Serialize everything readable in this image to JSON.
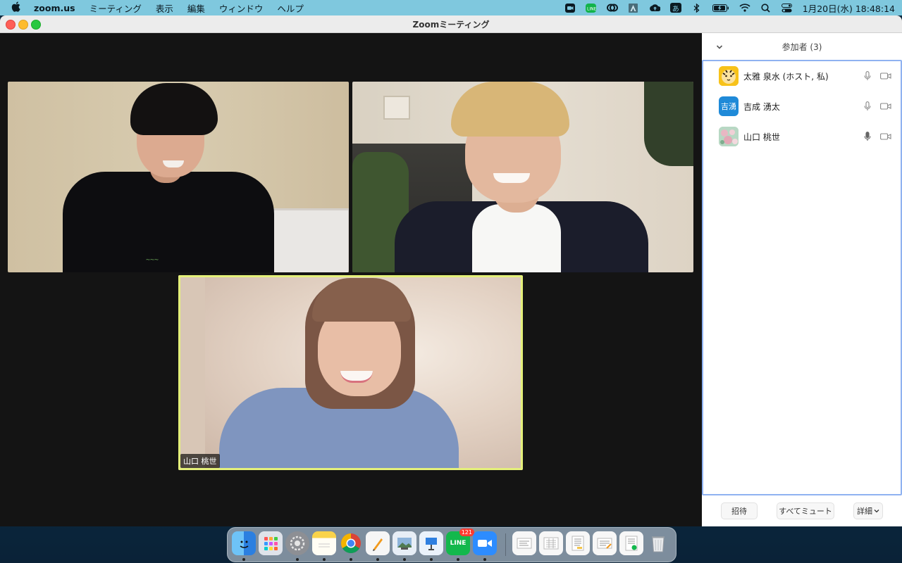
{
  "menubar": {
    "app_name": "zoom.us",
    "menus": [
      "ミーティング",
      "表示",
      "編集",
      "ウィンドウ",
      "ヘルプ"
    ],
    "clock": "1月20日(水)  18:48:14",
    "status_icons": [
      "zoom-icon",
      "line-icon",
      "creative-cloud-icon",
      "adobe-icon",
      "cloud-upload-icon",
      "input-method-icon",
      "bluetooth-icon",
      "battery-icon",
      "wifi-icon",
      "search-icon",
      "control-center-icon"
    ],
    "input_method": "あ"
  },
  "window": {
    "title": "Zoomミーティング"
  },
  "video": {
    "active_speaker_name": "山口 桃世",
    "active_speaker_color": "#e4f07a"
  },
  "participants": {
    "header": "参加者 (3)",
    "list": [
      {
        "name": "太雅 泉水 (ホスト, 私)",
        "avatar_type": "image",
        "avatar_color": "#f2b400"
      },
      {
        "name": "吉成 湧太",
        "avatar_type": "initials",
        "avatar_text": "吉湧",
        "avatar_color": "#1f8ad8"
      },
      {
        "name": "山口 桃世",
        "avatar_type": "image",
        "avatar_color": "#a6cfb6"
      }
    ],
    "buttons": {
      "invite": "招待",
      "mute_all": "すべてミュート",
      "more": "詳細"
    }
  },
  "dock": {
    "line_badge": "121",
    "apps": [
      "finder-icon",
      "launchpad-icon",
      "system-preferences-icon",
      "notes-icon",
      "chrome-icon",
      "pages-icon",
      "preview-icon",
      "keynote-icon",
      "line-icon",
      "zoom-icon"
    ],
    "recents": [
      "document-1-icon",
      "document-2-icon",
      "document-3-icon",
      "document-4-icon",
      "document-5-icon",
      "trash-icon"
    ]
  }
}
